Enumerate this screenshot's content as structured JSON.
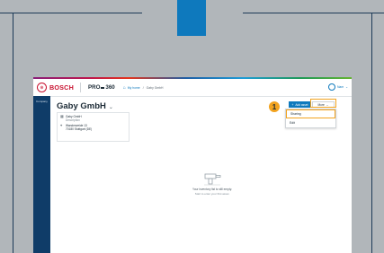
{
  "header": {
    "brand_symbol": "⊕",
    "brand": "BOSCH",
    "product_left": "PRO",
    "product_box": "",
    "product_right": "360",
    "breadcrumb": [
      "My home",
      "Gaby GmbH"
    ],
    "user_label": "Nam"
  },
  "sidebar": {
    "items": [
      {
        "label": "Company"
      }
    ]
  },
  "page": {
    "title": "Gaby GmbH",
    "card": {
      "name": "Gaby GmbH",
      "description": "Description",
      "address_line1": "Wanderweide 13",
      "address_line2": "70180 Stuttgart (DE)"
    },
    "buttons": {
      "add_asset": "Add asset",
      "more": "More"
    },
    "dropdown": {
      "items": [
        "Sharing",
        "Edit"
      ]
    },
    "step_badge": "1",
    "empty_state": {
      "title": "Your inventory list is still empty.",
      "subtitle": "Start to enter your first asset."
    }
  },
  "colors": {
    "accent": "#0e79bd",
    "highlight": "#f2a31f",
    "sidebar": "#0f3c68",
    "brand_red": "#c8102e"
  }
}
